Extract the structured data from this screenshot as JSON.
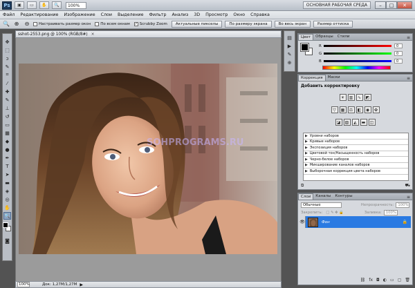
{
  "titlebar": {
    "logo": "Ps",
    "zoom": "100%",
    "workspace": "ОСНОВНАЯ РАБОЧАЯ СРЕДА",
    "buttons": [
      "▣",
      "▭",
      "✋",
      "🔍"
    ],
    "window_controls": [
      "–",
      "□",
      "✕"
    ]
  },
  "menu": [
    "Файл",
    "Редактирование",
    "Изображение",
    "Слои",
    "Выделение",
    "Фильтр",
    "Анализ",
    "3D",
    "Просмотр",
    "Окно",
    "Справка"
  ],
  "options": {
    "icons": [
      "🔍",
      "⊕",
      "⊖"
    ],
    "check_resize": "Настраивать размер окон",
    "check_all": "По всем окнам",
    "check_scrubby": "Scrubby Zoom",
    "btn_actual": "Актуальные пикселы",
    "btn_fit": "По размеру экрана",
    "btn_fill": "Во весь экран",
    "btn_print": "Размер оттиска"
  },
  "document": {
    "tab_title": "sshot-2553.png @ 100% (RGB/8#)",
    "close": "×",
    "status_zoom": "100%",
    "status_doc": "Док: 1,27М/1,27М"
  },
  "color_panel": {
    "tabs": [
      "Цвет",
      "Образцы",
      "Стили"
    ],
    "r_label": "R",
    "g_label": "G",
    "b_label": "B",
    "r_value": "0",
    "g_value": "0",
    "b_value": "0"
  },
  "adjustments": {
    "tabs": [
      "Коррекция",
      "Маски"
    ],
    "title": "Добавить корректировку",
    "presets": [
      "Уровни наборов",
      "Кривые наборов",
      "Экспозиция наборов",
      "Цветовой тон/Насыщенность наборов",
      "Черно-белое наборов",
      "Микширование каналов наборов",
      "Выборочная коррекция цвета наборов"
    ]
  },
  "layers": {
    "tabs": [
      "Слои",
      "Каналы",
      "Контуры"
    ],
    "blend_mode": "Обычные",
    "opacity_label": "Непрозрачность:",
    "opacity_value": "100%",
    "lock_label": "Закрепить:",
    "fill_label": "Заливка:",
    "fill_value": "100%",
    "layer_name": "Фон"
  },
  "colors": {
    "layer_selected": "#2a7ae2",
    "panel_bg": "#d6d9de"
  }
}
